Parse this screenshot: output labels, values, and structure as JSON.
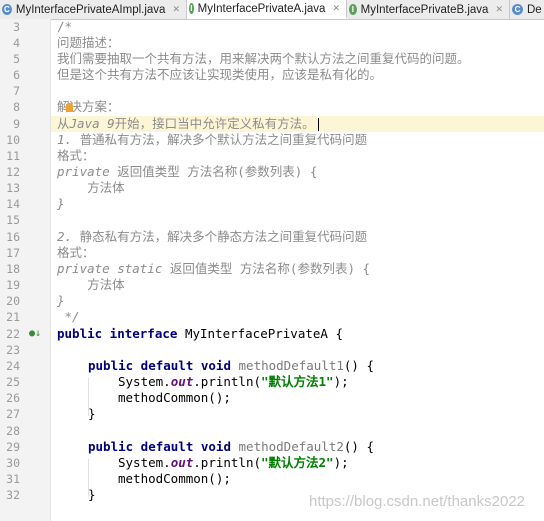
{
  "tabs": [
    {
      "label": "MyInterfacePrivateAImpl.java",
      "active": false
    },
    {
      "label": "MyInterfacePrivateA.java",
      "active": true
    },
    {
      "label": "MyInterfacePrivateB.java",
      "active": false
    },
    {
      "label": "De",
      "active": false
    }
  ],
  "icons": {
    "tab_file": "interface-file-icon",
    "close": "close-icon",
    "implemented": "implemented-marker-icon",
    "intention": "lightbulb-icon"
  },
  "colors": {
    "keyword": "#000080",
    "string": "#008000",
    "comment": "#8c8c8c",
    "field": "#660e7a",
    "current_line": "#fcf6d6"
  },
  "lines": [
    {
      "n": "3",
      "text": "/*"
    },
    {
      "n": "4",
      "text": "问题描述："
    },
    {
      "n": "5",
      "text": "我们需要抽取一个共有方法，用来解决两个默认方法之间重复代码的问题。"
    },
    {
      "n": "6",
      "text": "但是这个共有方法不应该让实现类使用，应该是私有化的。"
    },
    {
      "n": "7",
      "text": ""
    },
    {
      "n": "8",
      "text": "解决方案："
    },
    {
      "n": "9",
      "a": "从",
      "b": "Java 9",
      "c": "开始，接口当中允许定义私有方法。"
    },
    {
      "n": "10",
      "a": "1. ",
      "b": "普通私有方法，解决多个默认方法之间重复代码问题"
    },
    {
      "n": "11",
      "text": "格式："
    },
    {
      "n": "12",
      "a": "private ",
      "b": "返回值类型 方法名称(参数列表) {"
    },
    {
      "n": "13",
      "text": "    方法体"
    },
    {
      "n": "14",
      "text": "}"
    },
    {
      "n": "15",
      "text": ""
    },
    {
      "n": "16",
      "a": "2. ",
      "b": "静态私有方法，解决多个静态方法之间重复代码问题"
    },
    {
      "n": "17",
      "text": "格式："
    },
    {
      "n": "18",
      "a": "private static ",
      "b": "返回值类型 方法名称(参数列表) {"
    },
    {
      "n": "19",
      "text": "    方法体"
    },
    {
      "n": "20",
      "text": "}"
    },
    {
      "n": "21",
      "text": " */"
    },
    {
      "n": "22",
      "kw": "public interface ",
      "rest": "MyInterfacePrivateA {"
    },
    {
      "n": "23",
      "text": ""
    },
    {
      "n": "24",
      "kw": "public default void ",
      "m": "methodDefault1",
      "rest": "() {"
    },
    {
      "n": "25",
      "a": "System.",
      "f": "out",
      "b": ".println(",
      "s": "\"默认方法1\"",
      "c": ");"
    },
    {
      "n": "26",
      "text": "methodCommon();"
    },
    {
      "n": "27",
      "text": "}"
    },
    {
      "n": "28",
      "text": ""
    },
    {
      "n": "29",
      "kw": "public default void ",
      "m": "methodDefault2",
      "rest": "() {"
    },
    {
      "n": "30",
      "a": "System.",
      "f": "out",
      "b": ".println(",
      "s": "\"默认方法2\"",
      "c": ");"
    },
    {
      "n": "31",
      "text": "methodCommon();"
    },
    {
      "n": "32",
      "text": "}"
    }
  ],
  "watermark": "https://blog.csdn.net/thanks2022"
}
